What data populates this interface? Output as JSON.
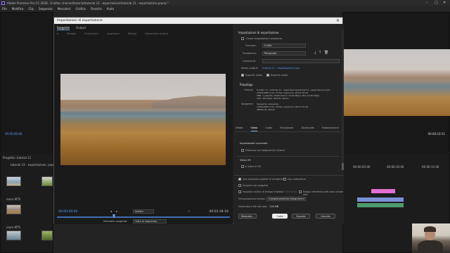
{
  "window": {
    "title": "Adobe Premiere Pro CC 2018 - E:\\altec channel\\tutorial\\tutorial 11 - esportazione\\tutorial 11 - esportazione.prproj *",
    "controls": [
      "–",
      "□",
      "✕"
    ]
  },
  "menubar": [
    "File",
    "Modifica",
    "Clip",
    "Sequenza",
    "Marcatori",
    "Grafica",
    "Finestra",
    "Aiuto"
  ],
  "background": {
    "source_timecode": "00;00;00;00",
    "program_timecode": "00:00:10:11",
    "project_title": "Progetto: tutorial 11",
    "project_item": "tutorial 11 - esportazione .prproj",
    "thumbs": [
      "mare.MTS",
      "mare.MTS",
      "mare.MTS",
      "mare.MTS"
    ],
    "timeline_times": [
      "00:00:05:00",
      "00:00:10:00",
      "00:00:15:00"
    ],
    "clip_label": "Altec ChannelTV"
  },
  "dialog": {
    "title": "Impostazioni di esportazione",
    "close_icon": "close-icon",
    "left_tabs": [
      "Sorgente",
      "Output"
    ],
    "tool_labels": [
      "Ritaglio",
      "Proporzioni",
      "Larghezza",
      "Altezza",
      "Dimensioni origine"
    ],
    "tc_in": "00:00:00:00",
    "tc_out": "00:01:34:16",
    "fit_value": "Adatta",
    "range_label": "Intervallo sorgente:",
    "range_value": "Tutta la sequenza",
    "export_settings": {
      "header": "Impostazioni di esportazione",
      "match_sequence": "Come impostazioni sequenza",
      "format_label": "Formato:",
      "format_value": "H.264",
      "preset_label": "Predefinito:",
      "preset_value": "Personale",
      "comments_label": "Commenti:",
      "output_name_label": "Nome output:",
      "output_name_value": "tutorial 11 - esportazione.mp4",
      "export_video": "Esporta video",
      "export_audio": "Esporta audio"
    },
    "summary": {
      "header": "Riepilogo",
      "output_label": "Output:",
      "output_lines": [
        "E:\\altec ch...\\tutorial 11 - esportazione\\tutorial 11 - esportazione.mp4",
        "1920x1080 (1,0), 25 fps, Superiore, 00:01:34:16",
        "VBR, 1 passata, Destinazione 10,00 Mbps, Max 12,00 Mbps",
        "AAC, 320 kbps, 48 kHz, Stereo"
      ],
      "source_label": "Sorgente:",
      "source_lines": [
        "Sequenza, sequenza",
        "1920x1080 (1,0), 25 fps, Superiore, 00:01:34:16",
        "48000 Hz, Stereo"
      ]
    },
    "right_tabs": [
      "Effetti",
      "Video",
      "Audio",
      "Multiplexer",
      "Didascalie",
      "Pubblicazione"
    ],
    "advanced": {
      "header": "Impostazioni avanzate",
      "keyframe_distance": "Distanza tra fotogrammi chiave:"
    },
    "vr": {
      "header": "Video VR",
      "is_vr": "Il video è VR"
    },
    "options": {
      "max_render_quality": "Usa massima qualità di rendering",
      "use_previews": "Usa anteprime",
      "import_into_project": "Importa nel progetto",
      "set_start_timecode": "Imposta codice di tempo iniziale",
      "start_timecode": "00:00:00:00",
      "alpha_only": "Esegui rendering del solo canale alfa",
      "time_interpolation_label": "Interpolazione tempo:",
      "time_interpolation_value": "Campionamento fotogrammi",
      "file_size_label": "Dimensioni file stimate:",
      "file_size_value": "116 MB"
    },
    "buttons": {
      "metadata": "Metadati...",
      "queue": "Coda",
      "export": "Esporta",
      "cancel": "Annulla"
    }
  }
}
